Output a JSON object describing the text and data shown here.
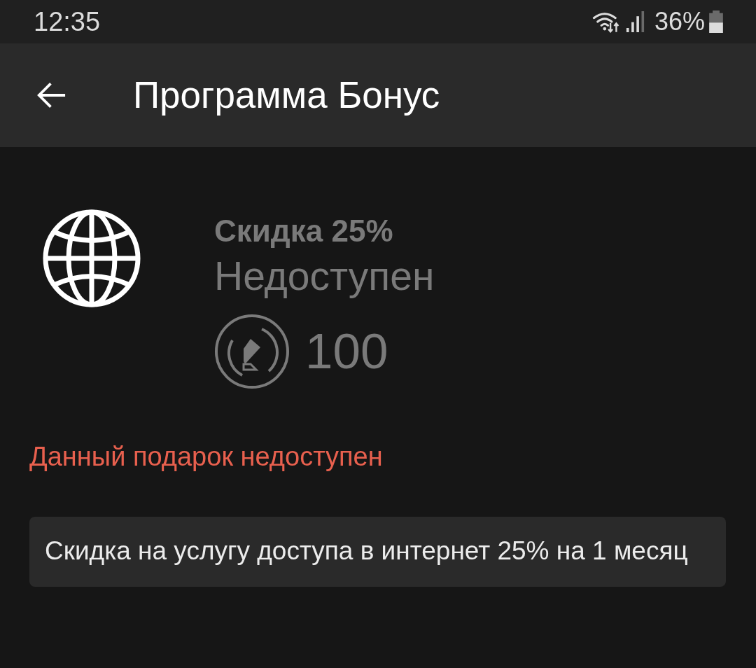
{
  "status_bar": {
    "time": "12:35",
    "battery": "36%"
  },
  "app_bar": {
    "title": "Программа Бонус"
  },
  "gift": {
    "title": "Скидка 25%",
    "status": "Недоступен",
    "available": false,
    "price": "100"
  },
  "message": "Данный подарок недоступен",
  "description": "Скидка на услугу доступа в интернет 25% на 1 месяц"
}
